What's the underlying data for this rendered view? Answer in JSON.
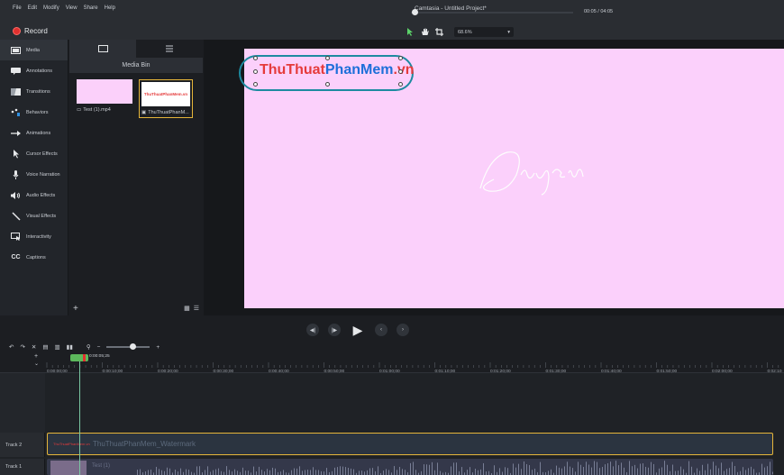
{
  "menu": {
    "items": [
      "File",
      "Edit",
      "Modify",
      "View",
      "Share",
      "Help"
    ],
    "title": "Camtasia - Untitled Project*"
  },
  "record": {
    "label": "Record"
  },
  "canvas_tools": {
    "icons": [
      "arrow-pointer-icon",
      "hand-pan-icon",
      "crop-icon"
    ],
    "zoom": "68.6%"
  },
  "rail": {
    "items": [
      {
        "label": "Media",
        "icon": "film-icon"
      },
      {
        "label": "Annotations",
        "icon": "speech-bubble-icon"
      },
      {
        "label": "Transitions",
        "icon": "transition-icon"
      },
      {
        "label": "Behaviors",
        "icon": "behaviors-icon"
      },
      {
        "label": "Animations",
        "icon": "animation-arrow-icon"
      },
      {
        "label": "Cursor Effects",
        "icon": "cursor-icon"
      },
      {
        "label": "Voice Narration",
        "icon": "microphone-icon"
      },
      {
        "label": "Audio Effects",
        "icon": "speaker-icon"
      },
      {
        "label": "Visual Effects",
        "icon": "magic-wand-icon"
      },
      {
        "label": "Interactivity",
        "icon": "interactivity-icon"
      },
      {
        "label": "Captions",
        "icon": "cc-icon"
      }
    ]
  },
  "bin": {
    "title": "Media Bin",
    "items": [
      {
        "name": "Test (1).mp4",
        "type": "video"
      },
      {
        "name": "ThuThuatPhanM...",
        "type": "image",
        "thumb_text": "ThuThuatPhanMem.vn"
      }
    ]
  },
  "canvas": {
    "watermark_red": "ThuThuat",
    "watermark_blue": "PhanMem",
    "watermark_red2": ".vn",
    "signature": "Duyen",
    "colors": {
      "background": "#fbd0fb",
      "watermark_red": "#e53b3b",
      "watermark_blue": "#1e6fd9",
      "highlight": "#1d8aa0"
    }
  },
  "playback": {
    "time": "00:05 / 04:05",
    "progress": 0.02
  },
  "timeline": {
    "playhead_time": "0:00:05;25",
    "ticks": [
      "0:00:00;00",
      "0:00:10;00",
      "0:00:20;00",
      "0:00:30;00",
      "0:00:40;00",
      "0:00:50;00",
      "0:01:00;00",
      "0:01:10;00",
      "0:01:20;00",
      "0:01:30;00",
      "0:01:40;00",
      "0:01:50;00",
      "0:02:00;00",
      "0:02:10"
    ],
    "tracks": [
      {
        "name": "Track 2",
        "clip": "ThuThuatPhanMem_Watermark",
        "clip_thumb": "ThuThuatPhanMem.vn"
      },
      {
        "name": "Track 1",
        "clip": "Test (1)"
      }
    ]
  }
}
